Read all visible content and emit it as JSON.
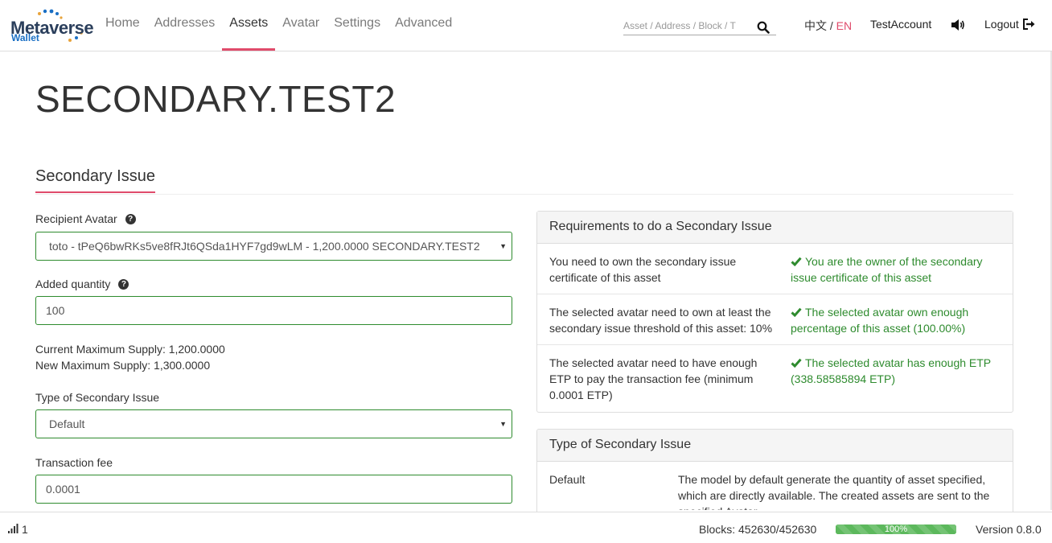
{
  "header": {
    "logo_text": "Metaverse",
    "logo_sub": "Wallet",
    "nav": [
      {
        "label": "Home"
      },
      {
        "label": "Addresses"
      },
      {
        "label": "Assets"
      },
      {
        "label": "Avatar"
      },
      {
        "label": "Settings"
      },
      {
        "label": "Advanced"
      }
    ],
    "active_nav": "Assets",
    "search_placeholder": "Asset / Address / Block / T",
    "lang_zh": "中文",
    "lang_sep": " / ",
    "lang_en": "EN",
    "account": "TestAccount",
    "logout": "Logout"
  },
  "page": {
    "title": "SECONDARY.TEST2",
    "section_title": "Secondary Issue"
  },
  "form": {
    "recipient_label": "Recipient Avatar",
    "recipient_value": "toto - tPeQ6bwRKs5ve8fRJt6QSda1HYF7gd9wLM - 1,200.0000 SECONDARY.TEST2",
    "quantity_label": "Added quantity",
    "quantity_value": "100",
    "current_supply": "Current Maximum Supply: 1,200.0000",
    "new_supply": "New Maximum Supply: 1,300.0000",
    "type_label": "Type of Secondary Issue",
    "type_value": "Default",
    "fee_label": "Transaction fee",
    "fee_value": "0.0001"
  },
  "requirements": {
    "title": "Requirements to do a Secondary Issue",
    "rows": [
      {
        "requirement": "You need to own the secondary issue certificate of this asset",
        "status": "You are the owner of the secondary issue certificate of this asset"
      },
      {
        "requirement": "The selected avatar need to own at least the secondary issue threshold of this asset: 10%",
        "status": "The selected avatar own enough percentage of this asset (100.00%)"
      },
      {
        "requirement": "The selected avatar need to have enough ETP to pay the transaction fee (minimum 0.0001 ETP)",
        "status": "The selected avatar has enough ETP (338.58585894 ETP)"
      }
    ],
    "status_color": "#2e8b2e"
  },
  "types": {
    "title": "Type of Secondary Issue",
    "rows": [
      {
        "name": "Default",
        "description": "The model by default generate the quantity of asset specified, which are directly available. The created assets are sent to the specified Avatar."
      }
    ]
  },
  "footer": {
    "peers": "1",
    "blocks": "Blocks: 452630/452630",
    "sync_percent": 100,
    "sync_label": "100%",
    "version": "Version 0.8.0"
  },
  "colors": {
    "accent": "#e04b6b",
    "success": "#2e8b2e",
    "progress": "#5cb85c"
  }
}
